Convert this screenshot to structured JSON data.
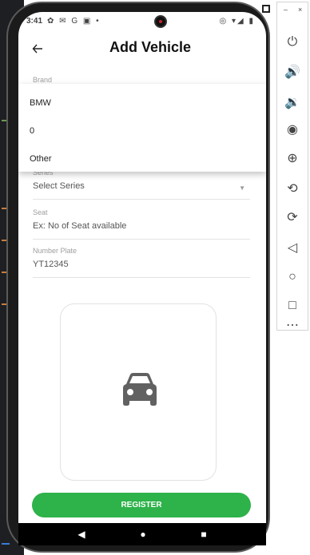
{
  "status_bar": {
    "time": "3:41",
    "left_icons": "✿ ✉ G ▣ •",
    "right_icons": "◎ ▾◢ ▮"
  },
  "app_bar": {
    "back_icon": "arrow-left-icon",
    "title": "Add Vehicle"
  },
  "brand_field": {
    "label": "Brand"
  },
  "brand_dropdown": {
    "options": [
      "BMW",
      "0",
      "Other"
    ]
  },
  "series_field": {
    "label": "Series",
    "placeholder": "Select Series"
  },
  "seat_field": {
    "label": "Seat",
    "placeholder": "Ex: No of Seat available"
  },
  "number_plate_field": {
    "label": "Number Plate",
    "value": "YT12345"
  },
  "image_picker": {
    "icon": "car-icon"
  },
  "register_button": {
    "label": "REGISTER"
  },
  "nav_bar": {
    "back": "◀",
    "home": "●",
    "recents": "■"
  },
  "emulator_panel": {
    "minimize": "–",
    "close": "×",
    "tools": [
      "⏻",
      "🔊",
      "🔉",
      "◉",
      "⊕",
      "⟲",
      "⟳",
      "◁",
      "○",
      "□",
      "⋯"
    ],
    "tool_names": [
      "power",
      "volume-up",
      "volume-down",
      "camera",
      "zoom",
      "rotate-left",
      "rotate-right",
      "back",
      "home",
      "overview",
      "more"
    ]
  },
  "colors": {
    "accent": "#2eb24a",
    "text": "#111111",
    "muted": "#9e9e9e"
  }
}
